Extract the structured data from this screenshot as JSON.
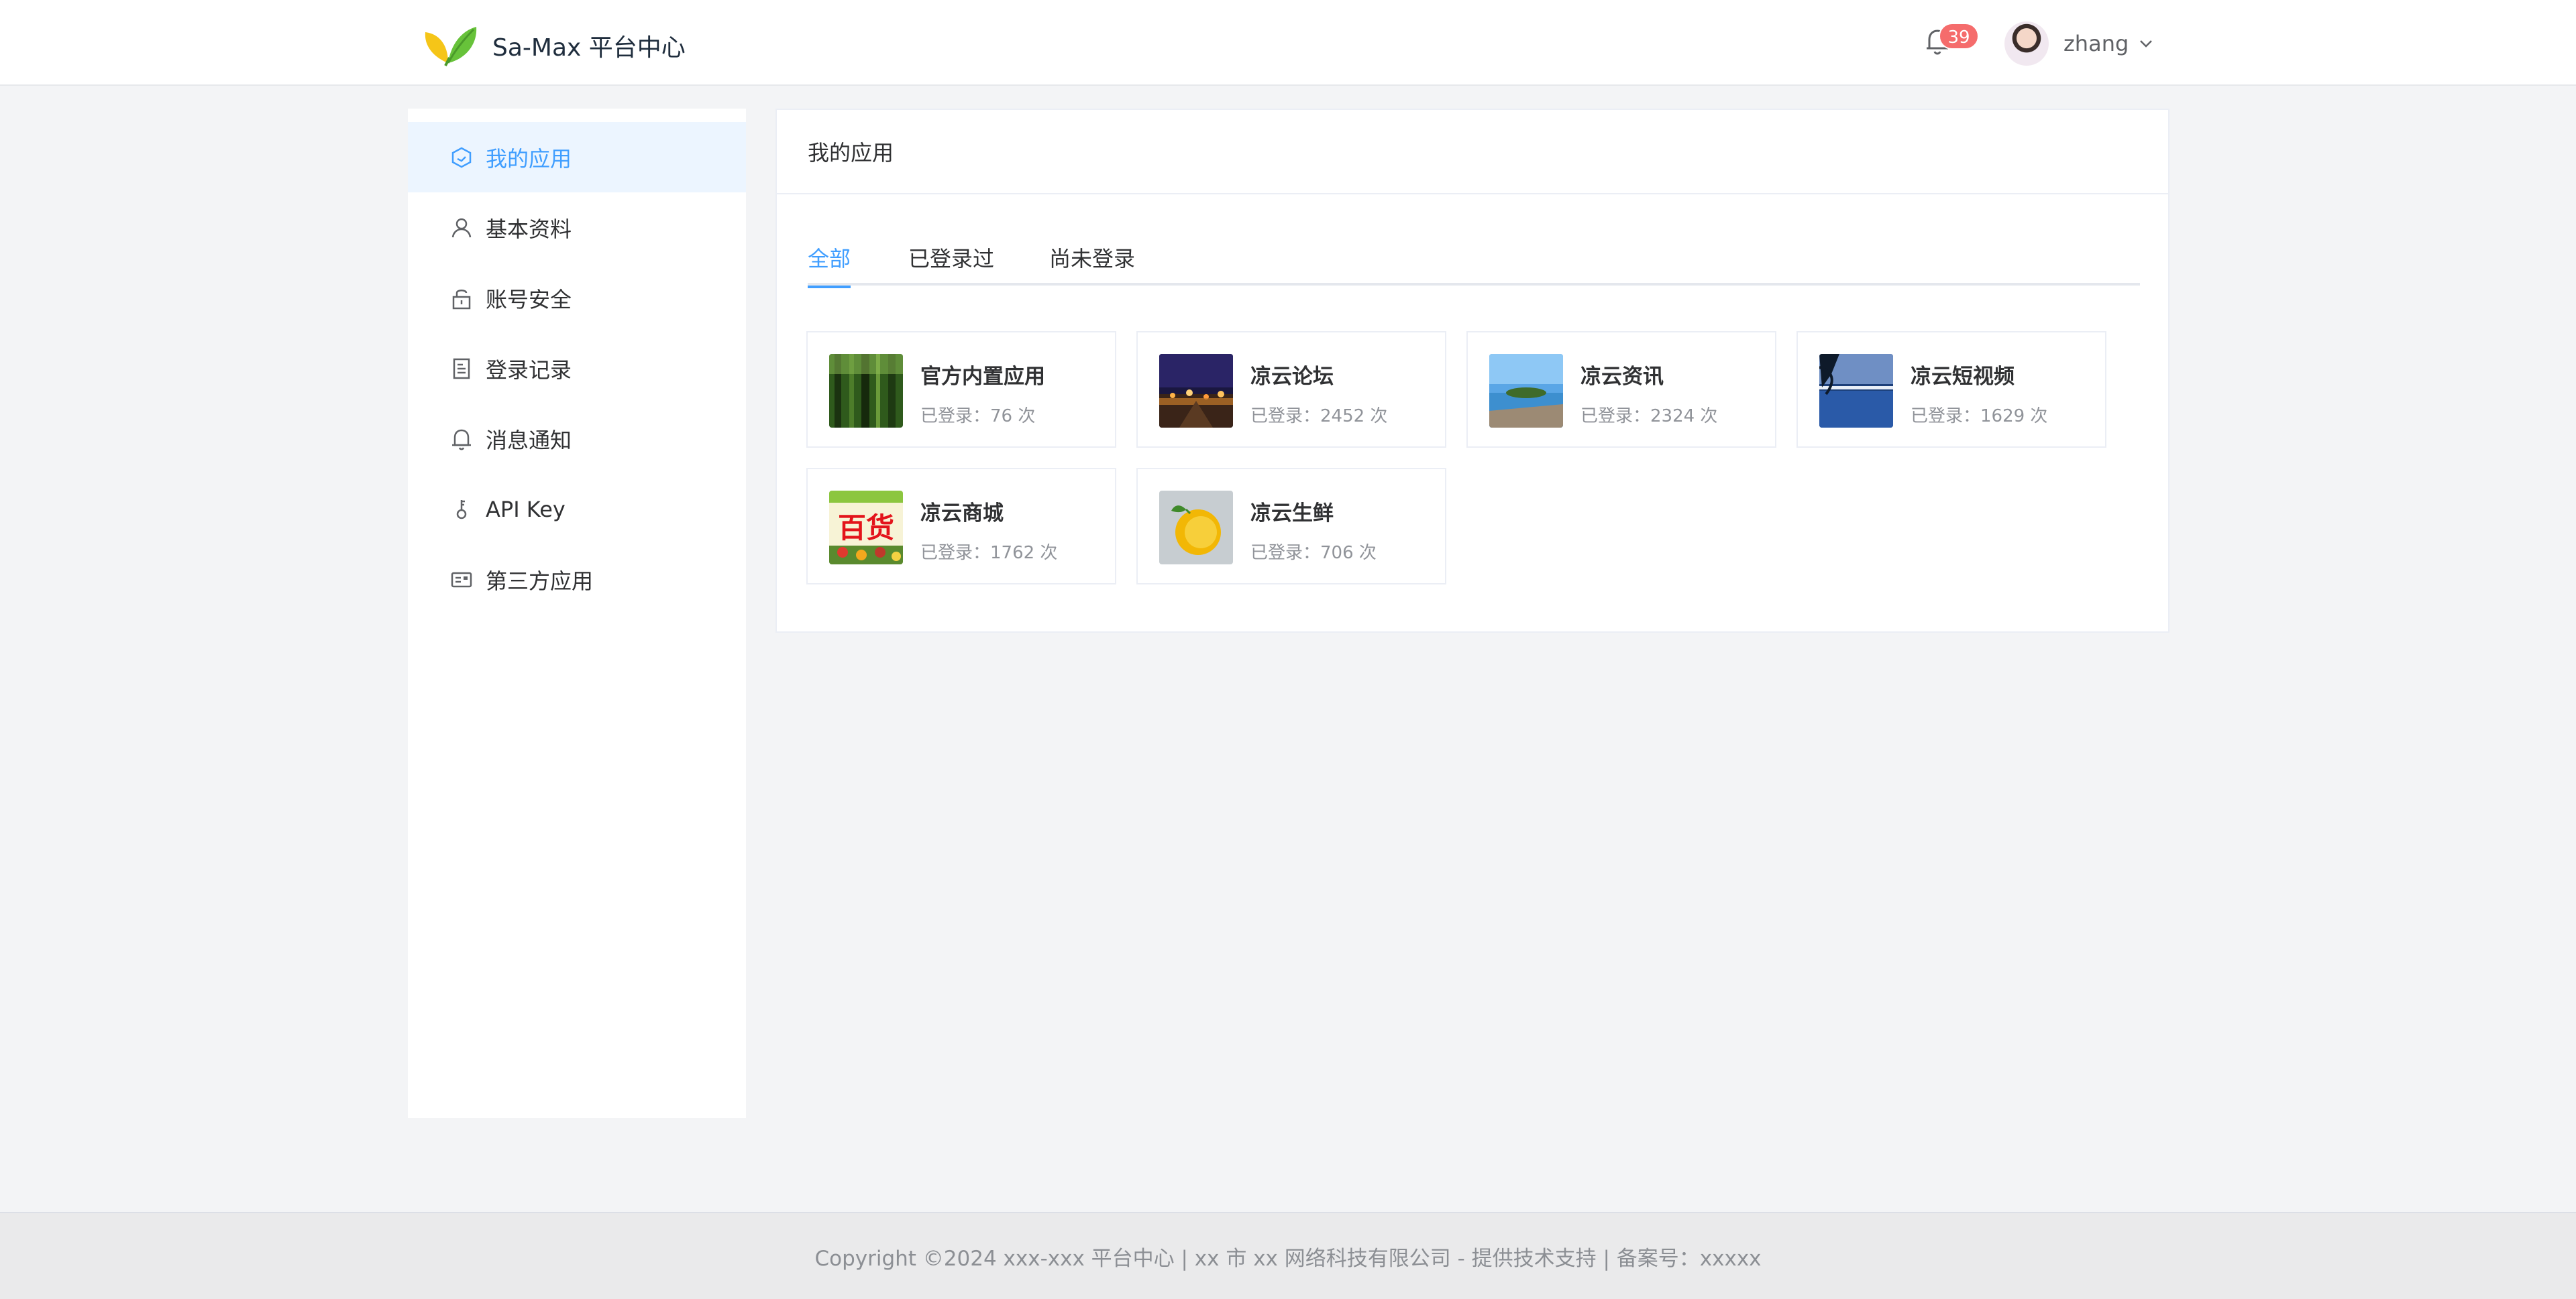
{
  "header": {
    "brand_title": "Sa-Max 平台中心",
    "notification_count": "39",
    "username": "zhang",
    "logo_icon": "leaf-logo-icon",
    "colors": {
      "accent": "#409eff",
      "badge": "#f56c6c"
    }
  },
  "sidebar": {
    "items": [
      {
        "label": "我的应用",
        "icon": "cube-icon",
        "active": true
      },
      {
        "label": "基本资料",
        "icon": "user-icon",
        "active": false
      },
      {
        "label": "账号安全",
        "icon": "unlock-icon",
        "active": false
      },
      {
        "label": "登录记录",
        "icon": "document-icon",
        "active": false
      },
      {
        "label": "消息通知",
        "icon": "bell-icon",
        "active": false
      },
      {
        "label": "API Key",
        "icon": "key-icon",
        "active": false
      },
      {
        "label": "第三方应用",
        "icon": "postcard-icon",
        "active": false
      }
    ]
  },
  "main": {
    "title": "我的应用",
    "tabs": [
      {
        "label": "全部",
        "active": true
      },
      {
        "label": "已登录过",
        "active": false
      },
      {
        "label": "尚未登录",
        "active": false
      }
    ],
    "apps": [
      {
        "name": "官方内置应用",
        "count": "已登录：76 次",
        "thumb": "forest-image"
      },
      {
        "name": "凉云论坛",
        "count": "已登录：2452 次",
        "thumb": "night-city-image"
      },
      {
        "name": "凉云资讯",
        "count": "已登录：2324 次",
        "thumb": "island-image"
      },
      {
        "name": "凉云短视频",
        "count": "已登录：1629 次",
        "thumb": "lake-image"
      },
      {
        "name": "凉云商城",
        "count": "已登录：1762 次",
        "thumb": "baihuo-image",
        "thumb_text": "百货"
      },
      {
        "name": "凉云生鲜",
        "count": "已登录：706 次",
        "thumb": "orange-image"
      }
    ]
  },
  "footer": {
    "text": "Copyright ©2024 xxx-xxx 平台中心 | xx 市 xx 网络科技有限公司 - 提供技术支持 | 备案号：xxxxx"
  }
}
